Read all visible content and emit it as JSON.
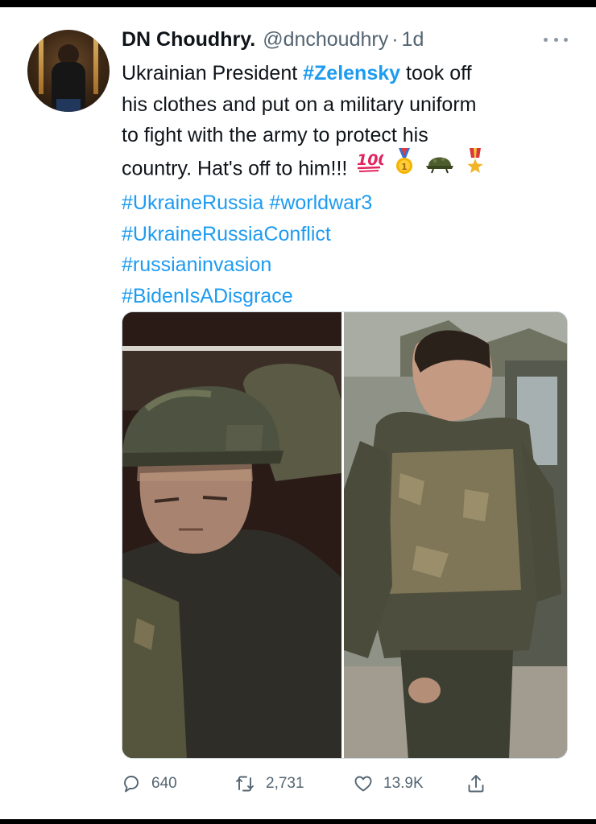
{
  "tweet": {
    "author": {
      "name": "DN Choudhry.",
      "handle": "@dnchoudhry",
      "separator": "·",
      "time": "1d"
    },
    "text": {
      "line1_a": "Ukrainian President ",
      "line1_hashtag": "#Zelensky",
      "line1_b": " took off",
      "line2": "his clothes and put on a military uniform",
      "line3": "to fight with the army to protect his",
      "line4": "country. Hat's off to him!!!",
      "emojis": [
        "100-emoji",
        "medal-emoji",
        "helmet-emoji",
        "military-medal-emoji"
      ],
      "hashtags_line1": [
        "#UkraineRussia",
        "#worldwar3"
      ],
      "hashtags": [
        "#UkraineRussiaConflict",
        "#russianinvasion",
        "#BidenIsADisgrace"
      ]
    },
    "media": {
      "left_photo": "soldier-in-helmet-photo",
      "right_photo": "soldier-in-vest-photo"
    },
    "actions": {
      "replies": "640",
      "retweets": "2,731",
      "likes": "13.9K"
    }
  },
  "colors": {
    "hashtag": "#1d9bf0",
    "secondary_text": "#536471",
    "primary_text": "#0f1419"
  }
}
